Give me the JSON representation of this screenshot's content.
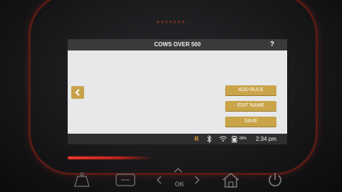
{
  "device": {
    "brand": "●●●●●●●",
    "ok_label": "OK",
    "hardware_buttons": [
      "weight-icon",
      "function-icon",
      "left-arrow-icon",
      "up-arrow-icon",
      "down-arrow-icon",
      "right-arrow-icon",
      "home-icon",
      "power-icon"
    ]
  },
  "screen": {
    "title": "COWS OVER 500",
    "help_label": "?",
    "buttons": {
      "add_rule": "ADD RULE",
      "edit_name": "EDIT NAME",
      "save": "SAVE"
    },
    "status": {
      "r_indicator": "R",
      "battery_percent": "88%",
      "time": "2:34 pm"
    }
  },
  "colors": {
    "accent_gold": "#c9a449",
    "led_red": "#ff3b2a"
  }
}
